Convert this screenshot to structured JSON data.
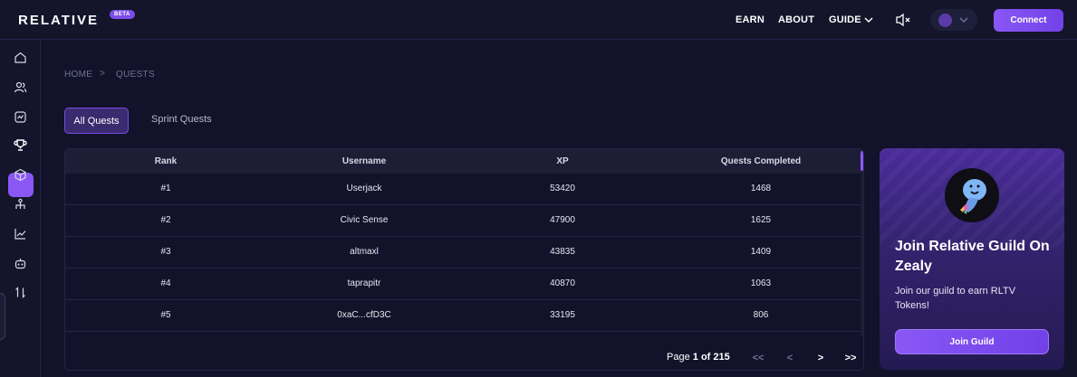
{
  "header": {
    "logo": "RELATIVE",
    "beta": "BETA",
    "nav": {
      "earn": "EARN",
      "about": "ABOUT",
      "guide": "GUIDE"
    },
    "connect_label": "Connect"
  },
  "sidebar": {
    "items": [
      "home-icon",
      "users-icon",
      "chart-square-icon",
      "trophy-icon",
      "cube-icon",
      "network-icon",
      "line-chart-icon",
      "robot-icon",
      "swap-icon"
    ],
    "active": "trophy-icon"
  },
  "breadcrumb": {
    "home": "HOME",
    "sep": ">",
    "current": "QUESTS"
  },
  "tabs": {
    "all": "All Quests",
    "sprint": "Sprint Quests"
  },
  "table": {
    "headers": {
      "rank": "Rank",
      "username": "Username",
      "xp": "XP",
      "quests": "Quests Completed"
    },
    "rows": [
      {
        "rank": "#1",
        "username": "Userjack",
        "xp": "53420",
        "quests": "1468"
      },
      {
        "rank": "#2",
        "username": "Civic Sense",
        "xp": "47900",
        "quests": "1625"
      },
      {
        "rank": "#3",
        "username": "altmaxl",
        "xp": "43835",
        "quests": "1409"
      },
      {
        "rank": "#4",
        "username": "taprapitr",
        "xp": "40870",
        "quests": "1063"
      },
      {
        "rank": "#5",
        "username": "0xaC...cfD3C",
        "xp": "33195",
        "quests": "806"
      }
    ]
  },
  "pagination": {
    "page_word": "Page",
    "current": "1",
    "of_text": "of 215",
    "first": "<<",
    "prev": "<",
    "next": ">",
    "last": ">>"
  },
  "zealy_card": {
    "title": "Join Relative Guild On Zealy",
    "description": "Join our guild to earn RLTV Tokens!",
    "button": "Join Guild"
  },
  "colors": {
    "accent": "#8a57f5",
    "background": "#12132a",
    "panel": "#14152b"
  }
}
